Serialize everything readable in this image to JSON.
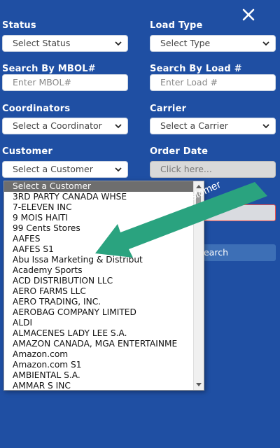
{
  "filters": {
    "status": {
      "label": "Status",
      "value": "Select Status"
    },
    "load_type": {
      "label": "Load Type",
      "value": "Select Type"
    },
    "mbol": {
      "label": "Search By MBOL#",
      "placeholder": "Enter MBOL#"
    },
    "load_number": {
      "label": "Search By Load #",
      "placeholder": "Enter Load #"
    },
    "coordinators": {
      "label": "Coordinators",
      "value": "Select a Coordinator"
    },
    "carrier": {
      "label": "Carrier",
      "value": "Select a Carrier"
    },
    "customer": {
      "label": "Customer",
      "value": "Select a Customer"
    },
    "order_date": {
      "label": "Order Date",
      "placeholder": "Click here..."
    }
  },
  "search_button": {
    "label": "earch"
  },
  "customer_dropdown": {
    "options": [
      "Select a Customer",
      "3RD PARTY CANADA WHSE",
      "7-ELEVEN INC",
      "9 MOIS HAITI",
      "99 Cents Stores",
      "AAFES",
      "AAFES S1",
      "Abu Issa Marketing & Distribut",
      "Academy Sports",
      "ACD DISTRIBUTION LLC",
      "AERO FARMS LLC",
      "AERO TRADING, INC.",
      "AEROBAG COMPANY LIMITED",
      "ALDI",
      "ALMACENES LADY LEE S.A.",
      "AMAZON CANADA, MGA ENTERTAINME",
      "Amazon.com",
      "Amazon.com S1",
      "AMBIENTAL S.A.",
      "AMMAR S INC"
    ],
    "selected_index": 0
  },
  "annotation": {
    "text": "Select Customer"
  },
  "colors": {
    "panel": "#1f4fa3",
    "callout": "#2aa37f",
    "selected_option": "#6e6e6e"
  }
}
